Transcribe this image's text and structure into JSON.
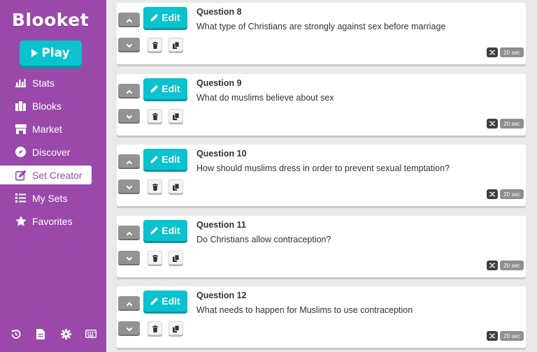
{
  "app": {
    "logo": "Blooket",
    "play_label": "Play"
  },
  "nav": [
    {
      "label": "Stats",
      "icon": "stats-icon",
      "active": false
    },
    {
      "label": "Blooks",
      "icon": "blooks-icon",
      "active": false
    },
    {
      "label": "Market",
      "icon": "market-icon",
      "active": false
    },
    {
      "label": "Discover",
      "icon": "compass-icon",
      "active": false
    },
    {
      "label": "Set Creator",
      "icon": "pencil-square-icon",
      "active": true
    },
    {
      "label": "My Sets",
      "icon": "list-icon",
      "active": false
    },
    {
      "label": "Favorites",
      "icon": "star-icon",
      "active": false
    }
  ],
  "footer_icons": [
    "history-icon",
    "document-icon",
    "gear-icon",
    "keyboard-icon"
  ],
  "edit_label": "Edit",
  "questions": [
    {
      "title": "Question 8",
      "text": "What type of Christians are strongly against sex before marriage",
      "time": "20 sec"
    },
    {
      "title": "Question 9",
      "text": "What do muslims believe about sex",
      "time": "20 sec"
    },
    {
      "title": "Question 10",
      "text": "How should muslims dress in order to prevent sexual temptation?",
      "time": "20 sec"
    },
    {
      "title": "Question 11",
      "text": "Do Christians allow contraception?",
      "time": "20 sec"
    },
    {
      "title": "Question 12",
      "text": "What needs to happen for Muslims to use contraception",
      "time": "20 sec"
    }
  ],
  "colors": {
    "sidebar": "#9a49aa",
    "accent": "#0bc2cf",
    "background": "#e9e9e9"
  }
}
